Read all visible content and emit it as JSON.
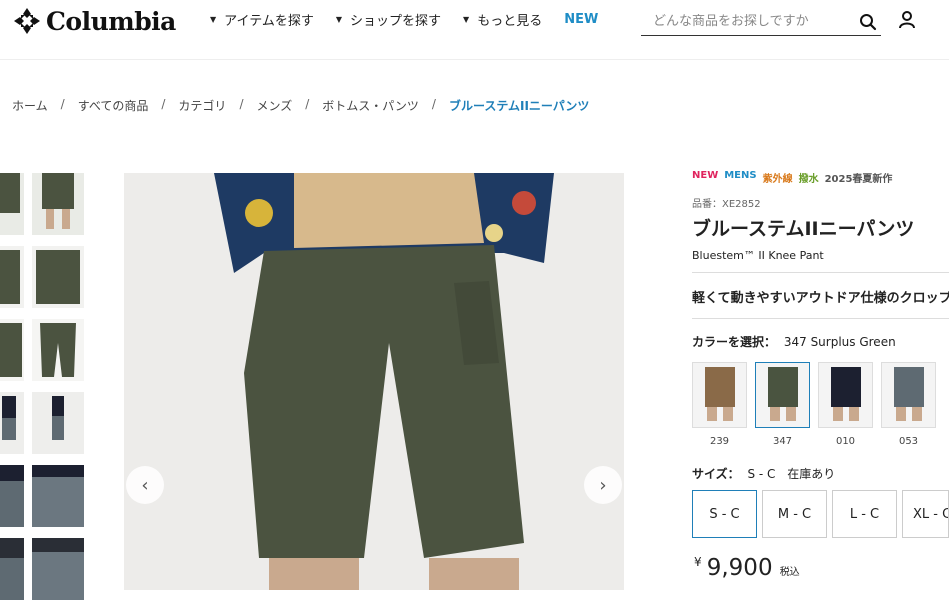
{
  "header": {
    "brand": "Columbia",
    "nav": [
      "アイテムを探す",
      "ショップを探す",
      "もっと見る"
    ],
    "nav_new": "NEW",
    "search_placeholder": "どんな商品をお探しですか"
  },
  "breadcrumb": [
    "ホーム",
    "すべての商品",
    "カテゴリ",
    "メンズ",
    "ボトムス・パンツ",
    "ブルーステムIIニーパンツ"
  ],
  "product": {
    "tags": [
      {
        "label": "NEW",
        "color": "#e0245e"
      },
      {
        "label": "MENS",
        "color": "#1f8dc6"
      },
      {
        "label": "紫外線",
        "color": "#d97a1c"
      },
      {
        "label": "撥水",
        "color": "#6a9e2a"
      },
      {
        "label": "2025春夏新作",
        "color": "#555555"
      }
    ],
    "sku": "品番：XE2852",
    "title": "ブルーステムIIニーパンツ",
    "subtitle": "Bluestem™ II Knee Pant",
    "catch": "軽くて動きやすいアウトドア仕様のクロップド",
    "color_label": "カラーを選択：",
    "color_value": "347 Surplus Green",
    "colors": [
      {
        "code": "239",
        "swatch": "#8a6a48"
      },
      {
        "code": "347",
        "swatch": "#4a5440"
      },
      {
        "code": "010",
        "swatch": "#1c2030"
      },
      {
        "code": "053",
        "swatch": "#5e6a72"
      }
    ],
    "size_label": "サイズ：",
    "size_value": "S - C",
    "stock": "在庫あり",
    "sizes": [
      "S - C",
      "M - C",
      "L - C",
      "XL - C"
    ],
    "price_symbol": "¥",
    "price": "9,900",
    "price_tax": "税込"
  },
  "colors": {
    "accent": "#1f7fb8",
    "pant": "#4b5340"
  }
}
